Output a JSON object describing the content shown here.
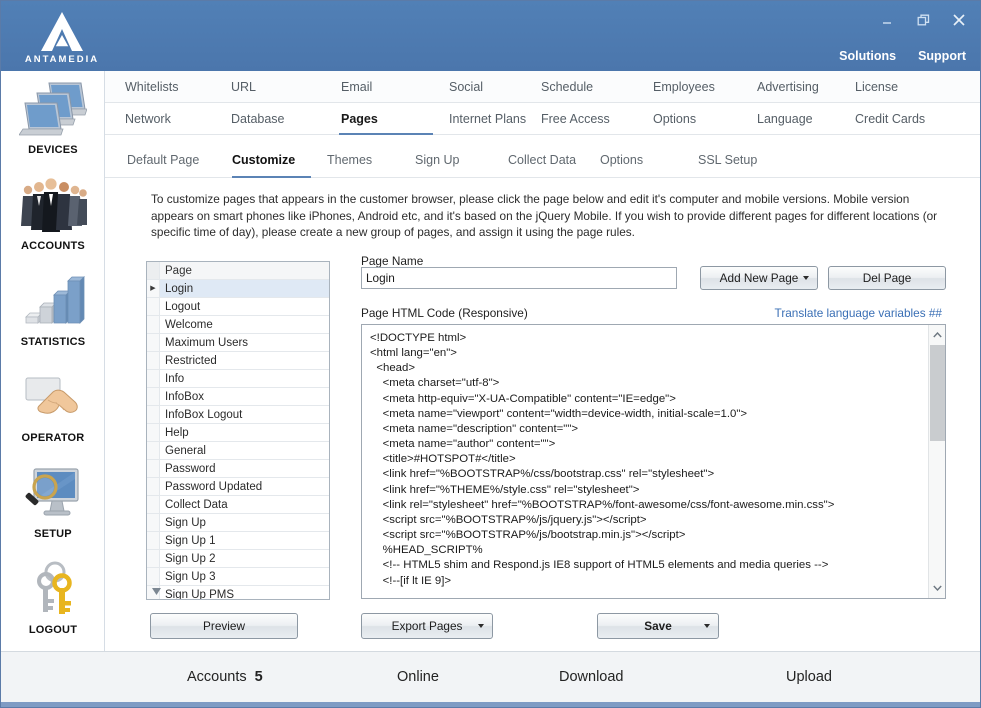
{
  "titlebar": {
    "logo_text": "ANTAMEDIA",
    "links": [
      {
        "label": "Solutions"
      },
      {
        "label": "Support"
      }
    ],
    "window_buttons": [
      {
        "name": "minimize-button",
        "glyph": "minimize"
      },
      {
        "name": "restore-button",
        "glyph": "restore"
      },
      {
        "name": "close-button",
        "glyph": "close"
      }
    ],
    "accent_color": "#4f7ab0"
  },
  "sidebar": {
    "items": [
      {
        "label": "DEVICES",
        "icon": "laptops-icon"
      },
      {
        "label": "ACCOUNTS",
        "icon": "people-group-icon"
      },
      {
        "label": "STATISTICS",
        "icon": "bar-chart-icon"
      },
      {
        "label": "OPERATOR",
        "icon": "hand-card-icon"
      },
      {
        "label": "SETUP",
        "icon": "monitor-magnifier-icon"
      },
      {
        "label": "LOGOUT",
        "icon": "keys-icon"
      }
    ]
  },
  "nav": {
    "row1": [
      {
        "label": "Whitelists",
        "active": false
      },
      {
        "label": "URL",
        "active": false
      },
      {
        "label": "Email",
        "active": false
      },
      {
        "label": "Social",
        "active": false
      },
      {
        "label": "Schedule",
        "active": false
      },
      {
        "label": "Employees",
        "active": false
      },
      {
        "label": "Advertising",
        "active": false
      },
      {
        "label": "License",
        "active": false
      }
    ],
    "row2": [
      {
        "label": "Network",
        "active": false
      },
      {
        "label": "Database",
        "active": false
      },
      {
        "label": "Pages",
        "active": true
      },
      {
        "label": "Internet Plans",
        "active": false
      },
      {
        "label": "Free Access",
        "active": false
      },
      {
        "label": "Options",
        "active": false
      },
      {
        "label": "Language",
        "active": false
      },
      {
        "label": "Credit Cards",
        "active": false
      }
    ],
    "subtabs": [
      {
        "label": "Default Page",
        "active": false
      },
      {
        "label": "Customize",
        "active": true
      },
      {
        "label": "Themes",
        "active": false
      },
      {
        "label": "Sign Up",
        "active": false
      },
      {
        "label": "Collect Data",
        "active": false
      },
      {
        "label": "Options",
        "active": false
      },
      {
        "label": "SSL Setup",
        "active": false
      }
    ],
    "active_underline_color": "#5b83b5"
  },
  "main": {
    "description": "To customize pages that appears in the customer browser, please click the page below and edit it's computer and mobile versions. Mobile version appears on smart phones like iPhones, Android etc, and it's based on the jQuery Mobile. If you wish to provide different pages for different locations (or specific time of day), please create a new group of pages, and assign it using the page rules.",
    "page_list": {
      "header": "Page",
      "selected": "Login",
      "rows": [
        "Login",
        "Logout",
        "Welcome",
        "Maximum Users",
        "Restricted",
        "Info",
        "InfoBox",
        "InfoBox Logout",
        "Help",
        "General",
        "Password",
        "Password Updated",
        "Collect Data",
        "Sign Up",
        "Sign Up 1",
        "Sign Up 2",
        "Sign Up 3",
        "Sign Up PMS"
      ]
    },
    "page_name_label": "Page Name",
    "page_name_value": "Login",
    "add_new_page_label": "Add New Page",
    "del_page_label": "Del Page",
    "html_code_label": "Page HTML Code (Responsive)",
    "translate_link": "Translate language variables ##",
    "translate_link_color": "#3a6fb5",
    "html_code": "<!DOCTYPE html>\n<html lang=\"en\">\n  <head>\n    <meta charset=\"utf-8\">\n    <meta http-equiv=\"X-UA-Compatible\" content=\"IE=edge\">\n    <meta name=\"viewport\" content=\"width=device-width, initial-scale=1.0\">\n    <meta name=\"description\" content=\"\">\n    <meta name=\"author\" content=\"\">\n    <title>#HOTSPOT#</title>\n    <link href=\"%BOOTSTRAP%/css/bootstrap.css\" rel=\"stylesheet\">\n    <link href=\"%THEME%/style.css\" rel=\"stylesheet\">\n    <link rel=\"stylesheet\" href=\"%BOOTSTRAP%/font-awesome/css/font-awesome.min.css\">\n    <script src=\"%BOOTSTRAP%/js/jquery.js\"></script>\n    <script src=\"%BOOTSTRAP%/js/bootstrap.min.js\"></script>\n    %HEAD_SCRIPT%\n    <!-- HTML5 shim and Respond.js IE8 support of HTML5 elements and media queries -->\n    <!--[if lt IE 9]>",
    "preview_label": "Preview",
    "export_pages_label": "Export Pages",
    "save_label": "Save"
  },
  "statusbar": {
    "items": [
      {
        "label": "Accounts",
        "value": "5"
      },
      {
        "label": "Online",
        "value": ""
      },
      {
        "label": "Download",
        "value": ""
      },
      {
        "label": "Upload",
        "value": ""
      }
    ]
  }
}
